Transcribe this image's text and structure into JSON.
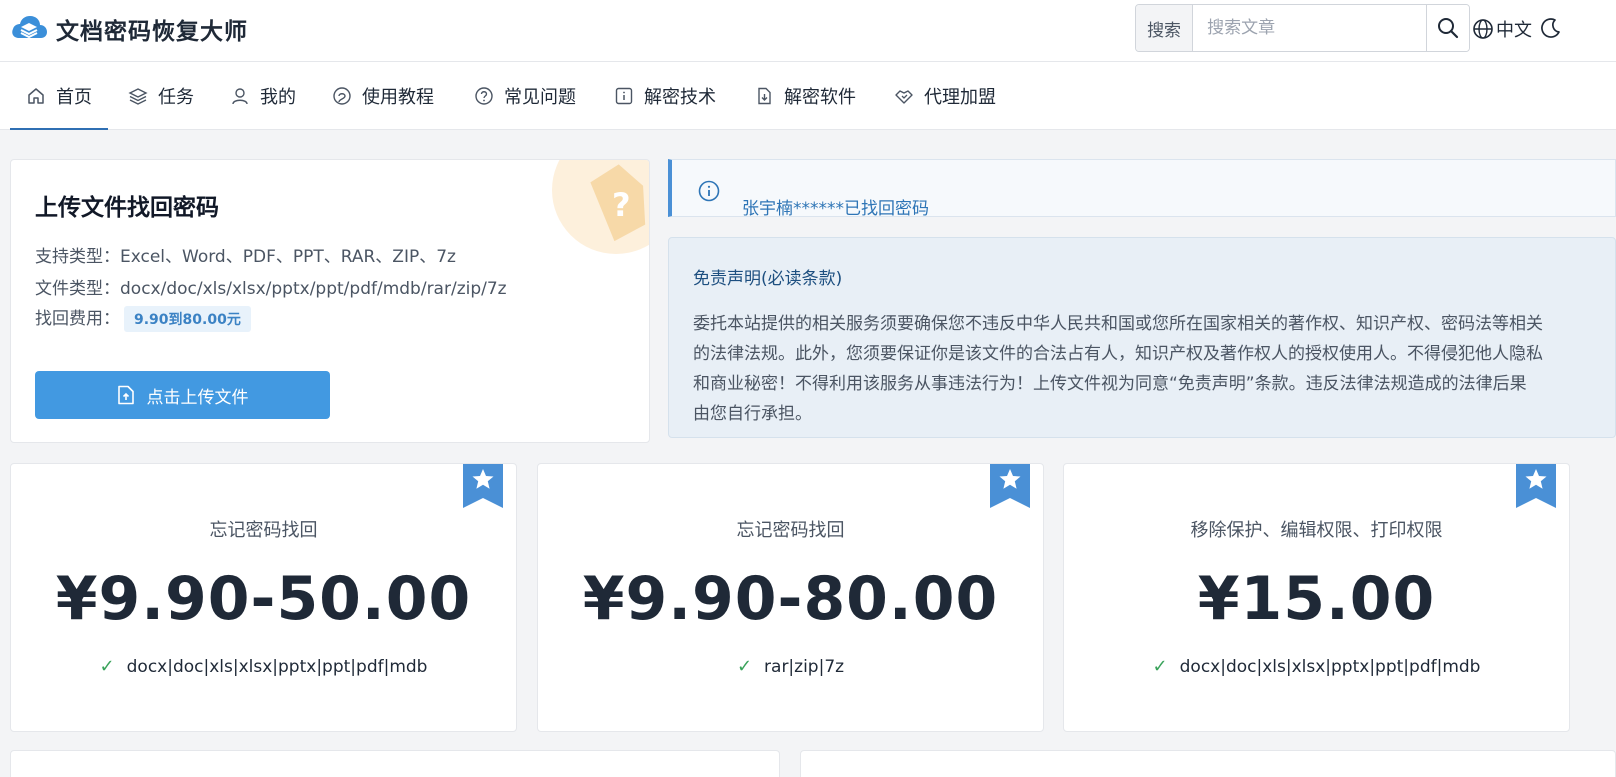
{
  "app": {
    "title": "文档密码恢复大师"
  },
  "header": {
    "search_label": "搜索",
    "search_placeholder": "搜索文章",
    "lang": "中文"
  },
  "nav": [
    {
      "label": "首页",
      "icon": "home-icon"
    },
    {
      "label": "任务",
      "icon": "layers-icon"
    },
    {
      "label": "我的",
      "icon": "user-icon"
    },
    {
      "label": "使用教程",
      "icon": "tutorial-icon"
    },
    {
      "label": "常见问题",
      "icon": "question-icon"
    },
    {
      "label": "解密技术",
      "icon": "info-icon"
    },
    {
      "label": "解密软件",
      "icon": "download-icon"
    },
    {
      "label": "代理加盟",
      "icon": "handshake-icon"
    }
  ],
  "upload": {
    "title": "上传文件找回密码",
    "support_types": "支持类型：Excel、Word、PDF、PPT、RAR、ZIP、7z",
    "file_types": "文件类型：docx/doc/xls/xlsx/pptx/ppt/pdf/mdb/rar/zip/7z",
    "fee_label": "找回费用：",
    "fee_value": "9.90到80.00元",
    "button_label": "点击上传文件"
  },
  "notice": {
    "text": "张宇楠******已找回密码"
  },
  "disclaimer": {
    "title": "免责声明(必读条款)",
    "body": "委托本站提供的相关服务须要确保您不违反中华人民共和国或您所在国家相关的著作权、知识产权、密码法等相关的法律法规。此外，您须要保证你是该文件的合法占有人，知识产权及著作权人的授权使用人。不得侵犯他人隐私和商业秘密！不得利用该服务从事违法行为！上传文件视为同意“免责声明”条款。违反法律法规造成的法律后果由您自行承担。"
  },
  "price_cards": [
    {
      "title": "忘记密码找回",
      "price": "¥9.90-50.00",
      "types": "docx|doc|xls|xlsx|pptx|ppt|pdf|mdb"
    },
    {
      "title": "忘记密码找回",
      "price": "¥9.90-80.00",
      "types": "rar|zip|7z"
    },
    {
      "title": "移除保护、编辑权限、打印权限",
      "price": "¥15.00",
      "types": "docx|doc|xls|xlsx|pptx|ppt|pdf|mdb"
    }
  ],
  "colors": {
    "accent": "#4299e1",
    "nav_active": "#2f6fb3",
    "ribbon": "#4a90d6",
    "check": "#3aa35b"
  }
}
